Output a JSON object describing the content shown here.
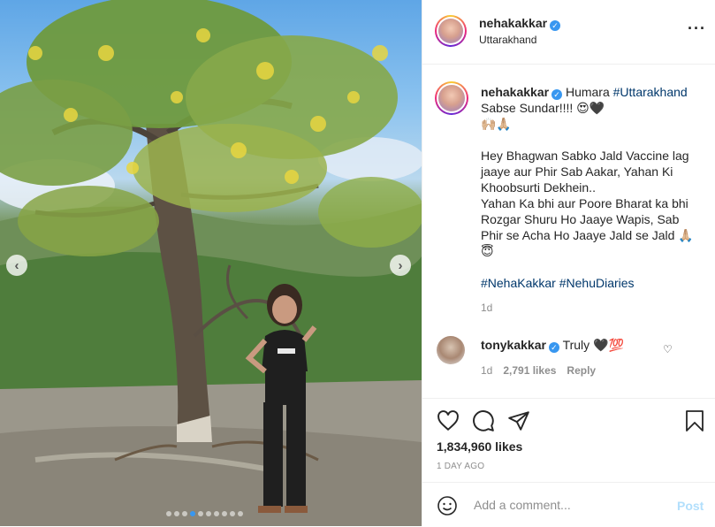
{
  "header": {
    "username": "nehakakkar",
    "location": "Uttarakhand",
    "more_icon": "more-options-icon"
  },
  "caption": {
    "username": "nehakakkar",
    "line1": "Humara",
    "hashtag1": "#Uttarakhand",
    "line1_rest": "Sabse Sundar!!!! 😍🖤",
    "line2": "🙌🏼🙏🏼",
    "para2_a": "Hey Bhagwan Sabko Jald Vaccine lag jaaye aur Phir Sab Aakar, Yahan Ki Khoobsurti Dekhein..",
    "para2_b": "Yahan Ka bhi aur Poore Bharat ka bhi Rozgar Shuru Ho Jaaye Wapis, Sab Phir se Acha Ho Jaaye Jald se Jald 🙏🏼😇",
    "hashtag2": "#NehaKakkar",
    "hashtag3": "#NehuDiaries",
    "time": "1d"
  },
  "comment": {
    "username": "tonykakkar",
    "text": "Truly 🖤💯",
    "time": "1d",
    "likes": "2,791 likes",
    "reply": "Reply"
  },
  "actions": {
    "likes": "1,834,960 likes",
    "posted": "1 DAY AGO"
  },
  "add_comment": {
    "placeholder": "Add a comment...",
    "post_label": "Post"
  },
  "media": {
    "prev_arrow": "‹",
    "next_arrow": "›",
    "carousel_dots": 10,
    "active_dot": 3
  },
  "colors": {
    "verified": "#3897f0",
    "hashtag": "#00376b",
    "post_button": "#b2dffc"
  }
}
